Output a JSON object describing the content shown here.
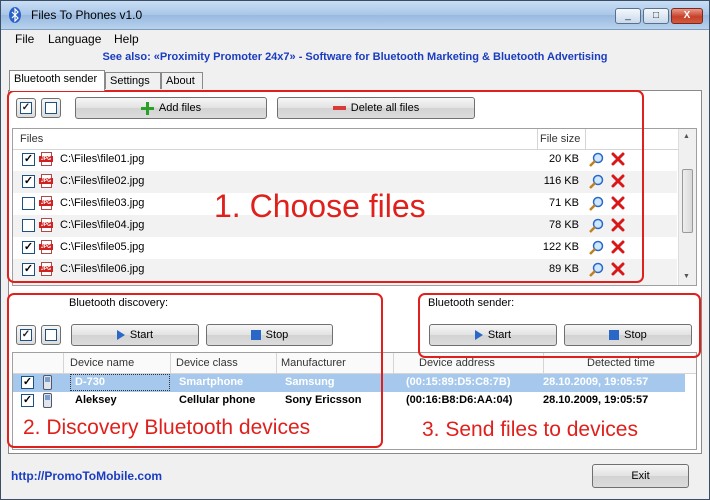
{
  "window": {
    "title": "Files To Phones v1.0",
    "controls": [
      "_",
      "□",
      "X"
    ]
  },
  "menu": [
    "File",
    "Language",
    "Help"
  ],
  "see_also": "See also: «Proximity Promoter 24x7» - Software for Bluetooth Marketing & Bluetooth Advertising",
  "tabs": [
    "Bluetooth sender",
    "Settings",
    "About"
  ],
  "files_toolbar": {
    "add": "Add files",
    "delete_all": "Delete all files"
  },
  "files_table": {
    "headers": {
      "files": "Files",
      "size": "File size"
    },
    "rows": [
      {
        "checked": true,
        "path": "C:\\Files\\file01.jpg",
        "size": "20 KB"
      },
      {
        "checked": true,
        "path": "C:\\Files\\file02.jpg",
        "size": "116 KB"
      },
      {
        "checked": false,
        "path": "C:\\Files\\file03.jpg",
        "size": "71 KB"
      },
      {
        "checked": false,
        "path": "C:\\Files\\file04.jpg",
        "size": "78 KB"
      },
      {
        "checked": true,
        "path": "C:\\Files\\file05.jpg",
        "size": "122 KB"
      },
      {
        "checked": true,
        "path": "C:\\Files\\file06.jpg",
        "size": "89 KB"
      }
    ]
  },
  "discovery": {
    "label": "Bluetooth discovery:",
    "start": "Start",
    "stop": "Stop"
  },
  "sender": {
    "label": "Bluetooth sender:",
    "start": "Start",
    "stop": "Stop"
  },
  "devices_table": {
    "headers": {
      "name": "Device name",
      "class": "Device class",
      "manufacturer": "Manufacturer",
      "address": "Device address",
      "time": "Detected time"
    },
    "rows": [
      {
        "checked": true,
        "name": "D-730",
        "class": "Smartphone",
        "manufacturer": "Samsung",
        "address": "(00:15:89:D5:C8:7B)",
        "time": "28.10.2009, 19:05:57",
        "selected": true
      },
      {
        "checked": true,
        "name": "Aleksey",
        "class": "Cellular phone",
        "manufacturer": "Sony Ericsson",
        "address": "(00:16:B8:D6:AA:04)",
        "time": "28.10.2009, 19:05:57",
        "selected": false
      }
    ]
  },
  "annotations": {
    "choose": "1. Choose files",
    "discover": "2. Discovery Bluetooth devices",
    "send": "3. Send files to devices"
  },
  "footer": {
    "url": "http://PromoToMobile.com",
    "exit": "Exit"
  },
  "colors": {
    "annotation": "#e0201c",
    "link": "#1a3cc0",
    "selection": "#a6c8ec"
  }
}
